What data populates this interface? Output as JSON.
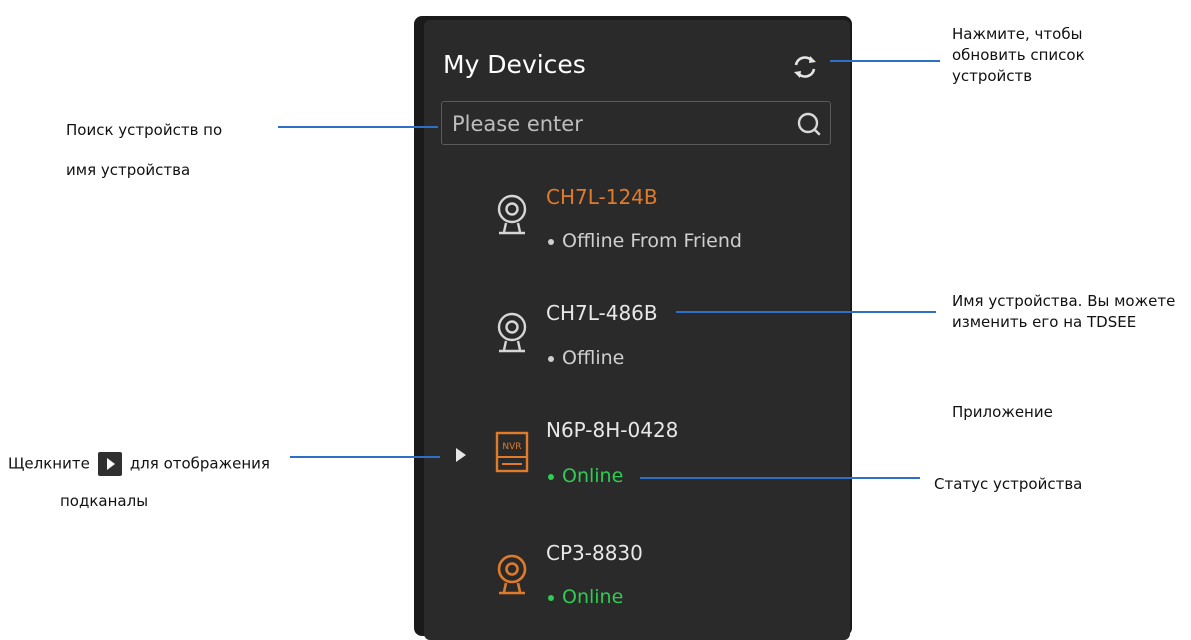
{
  "panel": {
    "title": "My Devices",
    "search": {
      "placeholder": "Please enter",
      "value": ""
    },
    "devices": [
      {
        "name": "CH7L-124B",
        "status": "Offline From Friend",
        "icon": "camera-icon",
        "name_color": "#e07b2a",
        "status_dot_color": "#cfcfcf",
        "status_color": "#cfcfcf"
      },
      {
        "name": "CH7L-486B",
        "status": "Offline",
        "icon": "camera-icon",
        "name_color": "#e8e8e8",
        "status_dot_color": "#cfcfcf",
        "status_color": "#cfcfcf"
      },
      {
        "name": "N6P-8H-0428",
        "status": "Online",
        "icon": "nvr-icon",
        "name_color": "#e8e8e8",
        "status_dot_color": "#2ecc52",
        "status_color": "#2ecc52"
      },
      {
        "name": "CP3-8830",
        "status": "Online",
        "icon": "camera-icon",
        "name_color": "#e8e8e8",
        "status_dot_color": "#2ecc52",
        "status_color": "#2ecc52"
      }
    ]
  },
  "callouts": {
    "refresh": "Нажмите, чтобы обновить список устройств",
    "search_line1": "Поиск устройств по",
    "search_line2": "имя устройства",
    "name": "Имя устройства. Вы можете изменить его на TDSEE",
    "app": "Приложение",
    "status": "Статус устройства",
    "expand_prefix": "Щелкните",
    "expand_suffix": "для отображения",
    "expand_line2": "подканалы"
  },
  "colors": {
    "accent_orange": "#e07b2a",
    "online_green": "#2ecc52",
    "callout_line": "#2e6fc8"
  }
}
